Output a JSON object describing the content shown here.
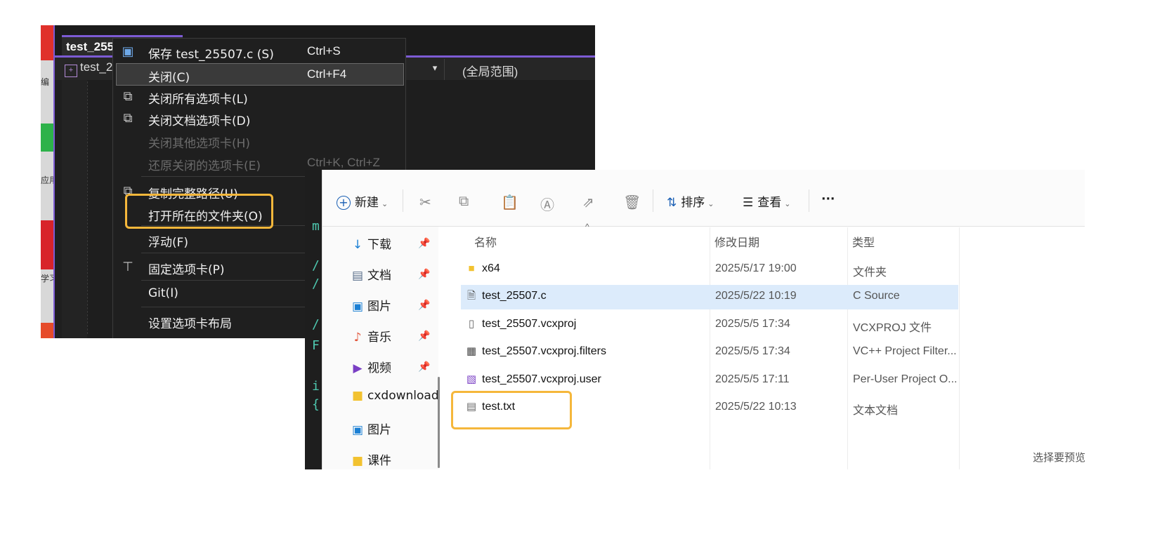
{
  "vs": {
    "active_tab": "test_255",
    "nav_file": "test_2",
    "nav_scope": "(全局范围)",
    "desk_labels": [
      "编",
      "应用",
      "学习"
    ],
    "code_fragments": [
      "m",
      "/",
      "/",
      "/",
      "F",
      "i",
      "{"
    ]
  },
  "context_menu": {
    "items": [
      {
        "label": "保存 test_25507.c (S)",
        "shortcut": "Ctrl+S"
      },
      {
        "label": "关闭(C)",
        "shortcut": "Ctrl+F4"
      },
      {
        "label": "关闭所有选项卡(L)",
        "shortcut": ""
      },
      {
        "label": "关闭文档选项卡(D)",
        "shortcut": ""
      },
      {
        "label": "关闭其他选项卡(H)",
        "shortcut": ""
      },
      {
        "label": "还原关闭的选项卡(E)",
        "shortcut": "Ctrl+K, Ctrl+Z"
      },
      {
        "label": "复制完整路径(U)",
        "shortcut": ""
      },
      {
        "label": "打开所在的文件夹(O)",
        "shortcut": ""
      },
      {
        "label": "浮动(F)",
        "shortcut": ""
      },
      {
        "label": "固定选项卡(P)",
        "shortcut": ""
      },
      {
        "label": "Git(I)",
        "shortcut": ""
      },
      {
        "label": "设置选项卡布局",
        "shortcut": ""
      }
    ]
  },
  "explorer": {
    "toolbar": {
      "new_label": "新建",
      "sort_label": "排序",
      "view_label": "查看",
      "more_label": "···"
    },
    "nav": [
      {
        "label": "下载",
        "icon": "download-icon",
        "pinned": true
      },
      {
        "label": "文档",
        "icon": "document-icon",
        "pinned": true
      },
      {
        "label": "图片",
        "icon": "picture-icon",
        "pinned": true
      },
      {
        "label": "音乐",
        "icon": "music-icon",
        "pinned": true
      },
      {
        "label": "视频",
        "icon": "video-icon",
        "pinned": true
      },
      {
        "label": "cxdownload",
        "icon": "folder-icon",
        "pinned": false
      },
      {
        "label": "图片",
        "icon": "picture-icon",
        "pinned": false
      },
      {
        "label": "课件",
        "icon": "folder-icon",
        "pinned": false
      }
    ],
    "columns": {
      "name": "名称",
      "date": "修改日期",
      "type": "类型"
    },
    "files": [
      {
        "name": "x64",
        "date": "2025/5/17 19:00",
        "type": "文件夹",
        "icon": "folder-icon"
      },
      {
        "name": "test_25507.c",
        "date": "2025/5/22 10:19",
        "type": "C Source",
        "icon": "c-source-icon",
        "selected": true
      },
      {
        "name": "test_25507.vcxproj",
        "date": "2025/5/5 17:34",
        "type": "VCXPROJ 文件",
        "icon": "file-icon"
      },
      {
        "name": "test_25507.vcxproj.filters",
        "date": "2025/5/5 17:34",
        "type": "VC++ Project Filter...",
        "icon": "filters-icon"
      },
      {
        "name": "test_25507.vcxproj.user",
        "date": "2025/5/5 17:11",
        "type": "Per-User Project O...",
        "icon": "user-file-icon"
      },
      {
        "name": "test.txt",
        "date": "2025/5/22 10:13",
        "type": "文本文档",
        "icon": "text-file-icon"
      }
    ],
    "preview_hint": "选择要预览的"
  },
  "colors": {
    "highlight": "#f5b73b",
    "vs_accent": "#7d5bd4",
    "selected_row": "#dcebfb"
  }
}
